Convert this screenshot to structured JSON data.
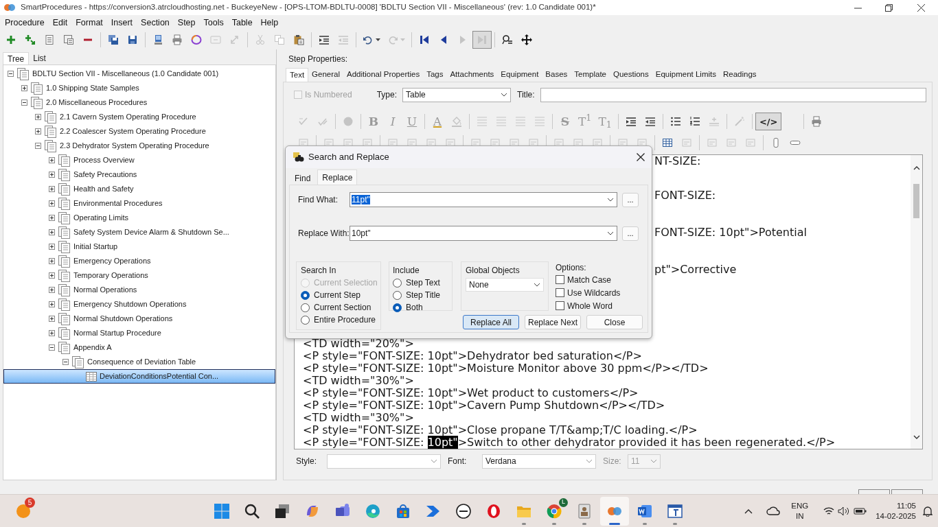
{
  "window": {
    "title": "SmartProcedures - https://conversion3.atrcloudhosting.net - BuckeyeNew - [OPS-LTOM-BDLTU-0008] 'BDLTU Section VII - Miscellaneous' (rev: 1.0 Candidate 001)*"
  },
  "menu": [
    "Procedure",
    "Edit",
    "Format",
    "Insert",
    "Section",
    "Step",
    "Tools",
    "Table",
    "Help"
  ],
  "toolbar": [
    {
      "kind": "add",
      "disabled": false,
      "pressed": false
    },
    {
      "kind": "addchild",
      "disabled": false,
      "pressed": false
    },
    {
      "kind": "list",
      "disabled": false,
      "pressed": false
    },
    {
      "kind": "doclist",
      "disabled": false,
      "pressed": false
    },
    {
      "kind": "remove",
      "disabled": false,
      "pressed": false
    },
    {
      "kind": "sep"
    },
    {
      "kind": "saveall",
      "disabled": false,
      "pressed": false
    },
    {
      "kind": "save",
      "disabled": false,
      "pressed": false
    },
    {
      "kind": "sep"
    },
    {
      "kind": "computer",
      "disabled": false,
      "pressed": false
    },
    {
      "kind": "printer",
      "disabled": false,
      "pressed": false
    },
    {
      "kind": "ring",
      "disabled": false,
      "pressed": false
    },
    {
      "kind": "frame",
      "disabled": true,
      "pressed": false
    },
    {
      "kind": "export",
      "disabled": true,
      "pressed": false
    },
    {
      "kind": "sep"
    },
    {
      "kind": "cut",
      "disabled": true,
      "pressed": false
    },
    {
      "kind": "copy",
      "disabled": true,
      "pressed": false
    },
    {
      "kind": "paste",
      "disabled": false,
      "pressed": false
    },
    {
      "kind": "sep"
    },
    {
      "kind": "indent",
      "disabled": false,
      "pressed": false
    },
    {
      "kind": "outdent",
      "disabled": true,
      "pressed": false
    },
    {
      "kind": "sep"
    },
    {
      "kind": "undo",
      "disabled": false,
      "pressed": false
    },
    {
      "kind": "redo",
      "disabled": true,
      "pressed": false
    },
    {
      "kind": "sep"
    },
    {
      "kind": "first",
      "disabled": false,
      "pressed": false
    },
    {
      "kind": "prev",
      "disabled": false,
      "pressed": false
    },
    {
      "kind": "next",
      "disabled": true,
      "pressed": false
    },
    {
      "kind": "last",
      "disabled": true,
      "pressed": true
    },
    {
      "kind": "sep"
    },
    {
      "kind": "find",
      "disabled": false,
      "pressed": false
    },
    {
      "kind": "move",
      "disabled": false,
      "pressed": false
    }
  ],
  "left_tabs": [
    {
      "label": "Tree",
      "selected": true
    },
    {
      "label": "List",
      "selected": false
    }
  ],
  "tree": [
    {
      "label": "BDLTU Section VII - Miscellaneous (1.0 Candidate 001)",
      "kind": "section",
      "expanded": true,
      "selected": false,
      "children": [
        {
          "label": "1.0 Shipping State Samples",
          "kind": "section",
          "expanded": false,
          "selected": false
        },
        {
          "label": "2.0 Miscellaneous Procedures",
          "kind": "section",
          "expanded": true,
          "selected": false,
          "children": [
            {
              "label": "2.1 Cavern System Operating Procedure",
              "kind": "section",
              "expanded": false,
              "selected": false
            },
            {
              "label": "2.2 Coalescer System Operating Procedure",
              "kind": "section",
              "expanded": false,
              "selected": false
            },
            {
              "label": "2.3 Dehydrator System Operating Procedure",
              "kind": "section",
              "expanded": true,
              "selected": false,
              "children": [
                {
                  "label": "Process Overview",
                  "kind": "section",
                  "expanded": false,
                  "selected": false
                },
                {
                  "label": "Safety Precautions",
                  "kind": "section",
                  "expanded": false,
                  "selected": false
                },
                {
                  "label": "Health and Safety",
                  "kind": "section",
                  "expanded": false,
                  "selected": false
                },
                {
                  "label": "Environmental Procedures",
                  "kind": "section",
                  "expanded": false,
                  "selected": false
                },
                {
                  "label": "Operating Limits",
                  "kind": "section",
                  "expanded": false,
                  "selected": false
                },
                {
                  "label": "Safety System Device Alarm & Shutdown Se...",
                  "kind": "section",
                  "expanded": false,
                  "selected": false
                },
                {
                  "label": "Initial Startup",
                  "kind": "section",
                  "expanded": false,
                  "selected": false
                },
                {
                  "label": "Emergency Operations",
                  "kind": "section",
                  "expanded": false,
                  "selected": false
                },
                {
                  "label": "Temporary Operations",
                  "kind": "section",
                  "expanded": false,
                  "selected": false
                },
                {
                  "label": "Normal Operations",
                  "kind": "section",
                  "expanded": false,
                  "selected": false
                },
                {
                  "label": "Emergency Shutdown Operations",
                  "kind": "section",
                  "expanded": false,
                  "selected": false
                },
                {
                  "label": "Normal Shutdown Operations",
                  "kind": "section",
                  "expanded": false,
                  "selected": false
                },
                {
                  "label": "Normal Startup Procedure",
                  "kind": "section",
                  "expanded": false,
                  "selected": false
                },
                {
                  "label": "Appendix A",
                  "kind": "section",
                  "expanded": true,
                  "selected": false,
                  "children": [
                    {
                      "label": "Consequence of Deviation Table",
                      "kind": "section",
                      "expanded": true,
                      "selected": false,
                      "children": [
                        {
                          "label": "DeviationConditionsPotential Con...",
                          "kind": "table",
                          "selected": true
                        }
                      ]
                    }
                  ]
                }
              ]
            }
          ]
        }
      ]
    }
  ],
  "step_properties": {
    "label": "Step Properties:",
    "tabs": [
      {
        "label": "Text",
        "selected": true
      },
      {
        "label": "General",
        "selected": false
      },
      {
        "label": "Additional Properties",
        "selected": false
      },
      {
        "label": "Tags",
        "selected": false
      },
      {
        "label": "Attachments",
        "selected": false
      },
      {
        "label": "Equipment",
        "selected": false
      },
      {
        "label": "Bases",
        "selected": false
      },
      {
        "label": "Template",
        "selected": false
      },
      {
        "label": "Questions",
        "selected": false
      },
      {
        "label": "Equipment Limits",
        "selected": false
      },
      {
        "label": "Readings",
        "selected": false
      }
    ],
    "is_numbered": {
      "label": "Is Numbered",
      "checked": false,
      "disabled": true
    },
    "type": {
      "label": "Type:",
      "value": "Table"
    },
    "title": {
      "label": "Title:"
    },
    "editor_toolbar": [
      {
        "kind": "spell",
        "disabled": true,
        "pressed": false
      },
      {
        "kind": "spell2",
        "disabled": true,
        "pressed": false
      },
      {
        "kind": "sep"
      },
      {
        "kind": "globe",
        "disabled": true,
        "pressed": false
      },
      {
        "kind": "sep"
      },
      {
        "kind": "bold",
        "text": "B",
        "disabled": true,
        "pressed": false
      },
      {
        "kind": "italic",
        "text": "I",
        "disabled": true,
        "pressed": false
      },
      {
        "kind": "underline",
        "text": "U",
        "disabled": true,
        "pressed": false
      },
      {
        "kind": "sep"
      },
      {
        "kind": "fontcolor",
        "text": "A",
        "disabled": true,
        "pressed": false
      },
      {
        "kind": "bucket",
        "disabled": true,
        "pressed": false
      },
      {
        "kind": "sep"
      },
      {
        "kind": "align",
        "disabled": true,
        "pressed": false
      },
      {
        "kind": "align",
        "disabled": true,
        "pressed": false
      },
      {
        "kind": "align",
        "disabled": true,
        "pressed": false
      },
      {
        "kind": "align",
        "disabled": true,
        "pressed": false
      },
      {
        "kind": "sep"
      },
      {
        "kind": "strike",
        "text": "S",
        "disabled": true,
        "pressed": false
      },
      {
        "kind": "script",
        "text": "T$^{1}$",
        "disabled": true,
        "pressed": false
      },
      {
        "kind": "script",
        "text": "T$_{1}$",
        "disabled": true,
        "pressed": false
      },
      {
        "kind": "sep"
      },
      {
        "kind": "indent",
        "disabled": false,
        "pressed": false
      },
      {
        "kind": "outdent",
        "disabled": false,
        "pressed": false
      },
      {
        "kind": "sep"
      },
      {
        "kind": "bullets",
        "disabled": false,
        "pressed": false
      },
      {
        "kind": "numbers",
        "disabled": false,
        "pressed": false
      },
      {
        "kind": "hr",
        "disabled": true,
        "pressed": false
      },
      {
        "kind": "sep"
      },
      {
        "kind": "wand",
        "disabled": true,
        "pressed": false
      },
      {
        "kind": "sep"
      },
      {
        "kind": "code",
        "text": "</>",
        "disabled": false,
        "pressed": true
      },
      {
        "kind": "gap"
      },
      {
        "kind": "sep"
      },
      {
        "kind": "printer",
        "disabled": false,
        "pressed": false
      }
    ],
    "editor_toolbar_2": [
      {
        "kind": "misc",
        "disabled": true
      },
      {
        "kind": "sep"
      },
      {
        "kind": "misc",
        "disabled": true
      },
      {
        "kind": "misc",
        "disabled": true
      },
      {
        "kind": "misc",
        "disabled": true
      },
      {
        "kind": "sep"
      },
      {
        "kind": "misc",
        "disabled": true
      },
      {
        "kind": "misc",
        "disabled": true
      },
      {
        "kind": "misc",
        "disabled": true
      },
      {
        "kind": "misc",
        "disabled": true
      },
      {
        "kind": "sep"
      },
      {
        "kind": "misc",
        "disabled": true
      },
      {
        "kind": "misc",
        "disabled": true
      },
      {
        "kind": "misc",
        "disabled": true
      },
      {
        "kind": "misc",
        "disabled": true
      },
      {
        "kind": "sep"
      },
      {
        "kind": "misc",
        "disabled": true
      },
      {
        "kind": "misc",
        "disabled": true
      },
      {
        "kind": "misc",
        "disabled": true
      },
      {
        "kind": "sep"
      },
      {
        "kind": "misc",
        "disabled": true
      },
      {
        "kind": "misc",
        "disabled": true
      },
      {
        "kind": "sep"
      },
      {
        "kind": "table",
        "disabled": false
      },
      {
        "kind": "misc",
        "disabled": true
      },
      {
        "kind": "sep"
      },
      {
        "kind": "misc",
        "disabled": true
      },
      {
        "kind": "misc",
        "disabled": true
      },
      {
        "kind": "misc",
        "disabled": true
      },
      {
        "kind": "sep"
      },
      {
        "kind": "cylinder",
        "disabled": false
      },
      {
        "kind": "pill",
        "disabled": false
      }
    ],
    "editor": {
      "partial_lines": [
        "NT-SIZE:",
        "FONT-SIZE:",
        "FONT-SIZE: 10pt\">Potential",
        "pt\">Corrective"
      ],
      "lines": [
        {
          "text": "<TD width=\"20%\">"
        },
        {
          "text": "<P style=\"FONT-SIZE: 10pt\">Dehydrator bed saturation</P>"
        },
        {
          "text": "<P style=\"FONT-SIZE: 10pt\">Moisture Monitor above 30 ppm</P></TD>"
        },
        {
          "text": "<TD width=\"30%\">"
        },
        {
          "text": "<P style=\"FONT-SIZE: 10pt\">Wet product to customers</P>"
        },
        {
          "text": "<P style=\"FONT-SIZE: 10pt\">Cavern Pump Shutdown</P></TD>"
        },
        {
          "text": "<TD width=\"30%\">"
        },
        {
          "text": "<P style=\"FONT-SIZE: 10pt\">Close propane T/T&amp;T/C loading.</P>"
        },
        {
          "text": "<P style=\"FONT-SIZE: ",
          "selection": "10pt\"",
          "after": ">Switch to other dehydrator provided it has been regenerated.</P>"
        }
      ]
    },
    "format_bar": {
      "style": {
        "label": "Style:"
      },
      "font": {
        "label": "Font:",
        "value": "Verdana"
      },
      "size": {
        "label": "Size:",
        "value": "11",
        "disabled": true
      }
    }
  },
  "dialog": {
    "title": "Search and Replace",
    "tabs": [
      {
        "label": "Find",
        "selected": false
      },
      {
        "label": "Replace",
        "selected": true
      }
    ],
    "find_what": {
      "label": "Find What:",
      "value": "11pt\"",
      "browse": "..."
    },
    "replace_with": {
      "label": "Replace With:",
      "value": "10pt\"",
      "browse": "..."
    },
    "search_in": {
      "label": "Search In",
      "options": [
        {
          "label": "Current Selection",
          "selected": false,
          "disabled": true
        },
        {
          "label": "Current Step",
          "selected": true,
          "disabled": false
        },
        {
          "label": "Current Section",
          "selected": false,
          "disabled": false
        },
        {
          "label": "Entire Procedure",
          "selected": false,
          "disabled": false
        }
      ]
    },
    "include": {
      "label": "Include",
      "options": [
        {
          "label": "Step Text",
          "selected": false,
          "disabled": false
        },
        {
          "label": "Step Title",
          "selected": false,
          "disabled": false
        },
        {
          "label": "Both",
          "selected": true,
          "disabled": false
        }
      ]
    },
    "global_objects": {
      "label": "Global Objects",
      "value": "None"
    },
    "options": {
      "label": "Options:",
      "items": [
        {
          "label": "Match Case",
          "checked": false
        },
        {
          "label": "Use Wildcards",
          "checked": false
        },
        {
          "label": "Whole Word",
          "checked": false
        }
      ]
    },
    "buttons": [
      {
        "label": "Replace All",
        "default": true
      },
      {
        "label": "Replace Next",
        "default": false
      },
      {
        "label": "Close",
        "default": false
      }
    ]
  },
  "taskbar": {
    "widget_badge": "5",
    "apps": [
      {
        "kind": "start",
        "selected": false,
        "running": false
      },
      {
        "kind": "search",
        "selected": false,
        "running": false
      },
      {
        "kind": "taskview",
        "selected": false,
        "running": false
      },
      {
        "kind": "copilot",
        "selected": false,
        "running": false
      },
      {
        "kind": "teams",
        "selected": false,
        "running": false
      },
      {
        "kind": "edge",
        "selected": false,
        "running": false
      },
      {
        "kind": "store",
        "selected": false,
        "running": false
      },
      {
        "kind": "automate",
        "selected": false,
        "running": false
      },
      {
        "kind": "dell",
        "selected": false,
        "running": false
      },
      {
        "kind": "opera",
        "selected": false,
        "running": false
      },
      {
        "kind": "explorer",
        "selected": false,
        "running": true
      },
      {
        "kind": "chrome",
        "badge": "L",
        "selected": false,
        "running": true
      },
      {
        "kind": "idcard",
        "selected": false,
        "running": true
      },
      {
        "kind": "smartprocedures",
        "selected": true,
        "running": true
      },
      {
        "kind": "word",
        "selected": false,
        "running": true
      },
      {
        "kind": "editor",
        "selected": false,
        "running": true
      }
    ],
    "language": "ENG",
    "region": "IN",
    "time": "11:05",
    "date": "14-02-2025"
  }
}
